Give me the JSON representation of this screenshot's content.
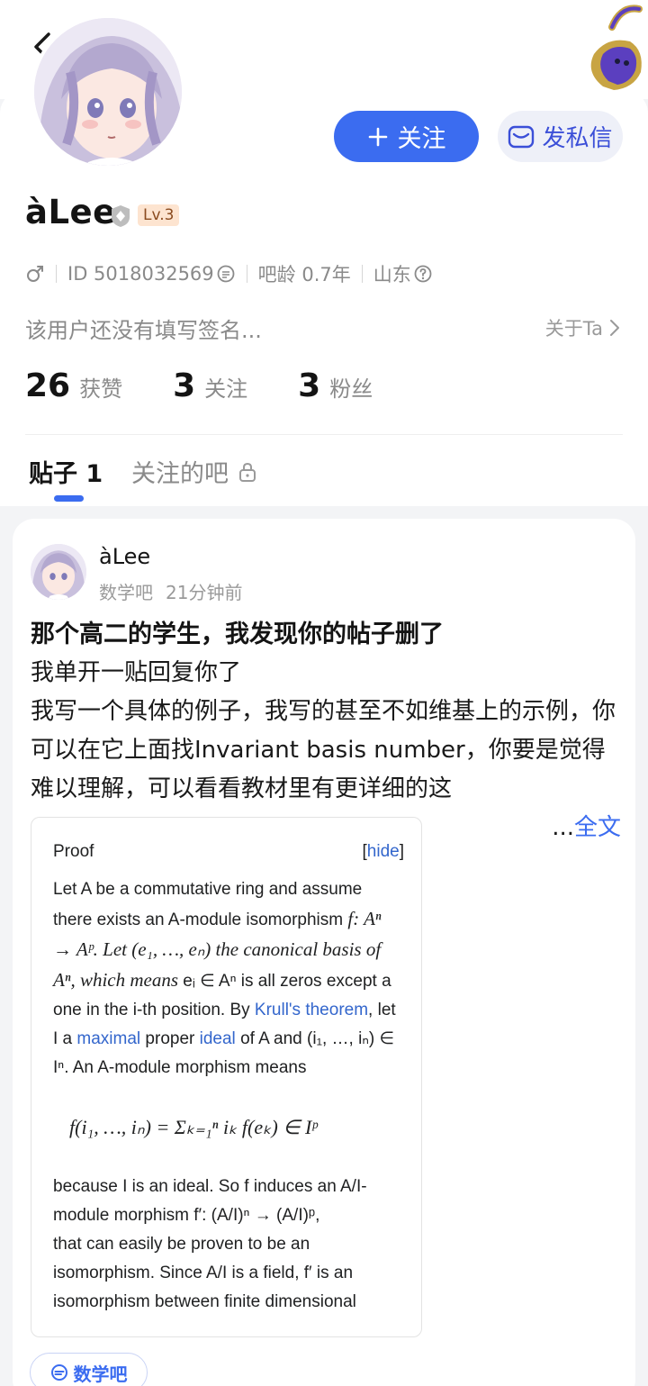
{
  "header": {
    "back_icon": "chevron-left-icon",
    "corner_icon": "scorpion-badge-icon"
  },
  "profile": {
    "username": "àLee",
    "level": "Lv.3",
    "gender_icon": "male-icon",
    "id_text": "ID 5018032569",
    "bar_age": "吧龄 0.7年",
    "location": "山东",
    "signature": "该用户还没有填写签名...",
    "about_label": "关于Ta",
    "follow_button": "关注",
    "message_button": "发私信",
    "accent_color": "#3b6cf0"
  },
  "stats": [
    {
      "value": "26",
      "label": "获赞"
    },
    {
      "value": "3",
      "label": "关注"
    },
    {
      "value": "3",
      "label": "粉丝"
    }
  ],
  "tabs": {
    "posts": "贴子 1",
    "followed_bars": "关注的吧"
  },
  "post": {
    "author": "àLee",
    "bar": "数学吧",
    "time": "21分钟前",
    "title": "那个高二的学生，我发现你的帖子删了",
    "line1": "我单开一贴回复你了",
    "line2": "我写一个具体的例子，我写的甚至不如维基上的示例，你可以在它上面找Invariant basis number，你要是觉得难以理解，可以看看教材里有更详细的这",
    "more_ellipsis": "...",
    "more_link": "全文",
    "tag": "数学吧"
  },
  "embed": {
    "heading": "Proof",
    "hide_link": "hide",
    "p1": "Let A be a commutative ring and assume there exists an A-module isomorphism",
    "p1b": "f: Aⁿ → Aᵖ. Let (e₁, …, eₙ) the canonical basis of Aⁿ, which means",
    "p1c": "eᵢ ∈ Aⁿ is all zeros except a one in the i-th position. By",
    "link_krull": "Krull's theorem",
    "p1d": ", let I a",
    "link_maximal": "maximal",
    "p1e": "proper",
    "link_ideal": "ideal",
    "p1f": "of A and (i₁, …, iₙ) ∈ Iⁿ. An A-module morphism means",
    "formula": "f(i₁, …, iₙ) = Σₖ₌₁ⁿ iₖ f(eₖ) ∈ Iᵖ",
    "p2": "because I is an ideal. So f induces an A/I-module morphism f′: (A/I)ⁿ → (A/I)ᵖ,",
    "p3": "that can easily be proven to be an isomorphism. Since A/I is a field, f′ is an isomorphism between finite dimensional"
  }
}
